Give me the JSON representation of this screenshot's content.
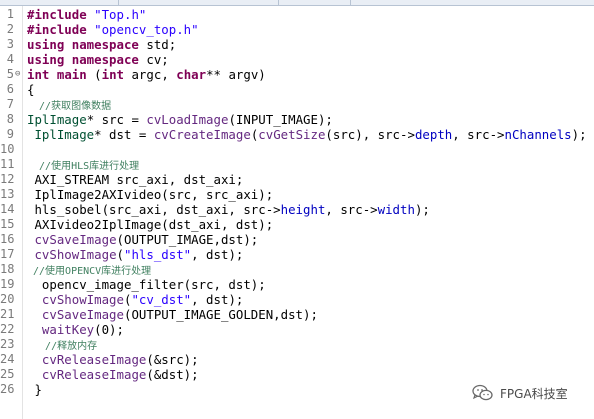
{
  "editor": {
    "line_numbers": [
      "1",
      "2",
      "3",
      "4",
      "5",
      "6",
      "7",
      "8",
      "9",
      "10",
      "11",
      "12",
      "13",
      "14",
      "15",
      "16",
      "17",
      "18",
      "19",
      "20",
      "21",
      "22",
      "23",
      "24",
      "25",
      "26"
    ],
    "fold_marker_line": "5",
    "code": [
      {
        "segs": [
          {
            "t": "#include ",
            "c": "pp"
          },
          {
            "t": "\"Top.h\"",
            "c": "str"
          }
        ]
      },
      {
        "segs": [
          {
            "t": "#include ",
            "c": "pp"
          },
          {
            "t": "\"opencv_top.h\"",
            "c": "str"
          }
        ]
      },
      {
        "segs": [
          {
            "t": "using namespace",
            "c": "kw"
          },
          {
            "t": " std;",
            "c": ""
          }
        ]
      },
      {
        "segs": [
          {
            "t": "using namespace",
            "c": "kw"
          },
          {
            "t": " cv;",
            "c": ""
          }
        ]
      },
      {
        "segs": [
          {
            "t": "int",
            "c": "kw"
          },
          {
            "t": " ",
            "c": ""
          },
          {
            "t": "main",
            "c": "kw"
          },
          {
            "t": " (",
            "c": ""
          },
          {
            "t": "int",
            "c": "kw"
          },
          {
            "t": " argc, ",
            "c": ""
          },
          {
            "t": "char",
            "c": "kw"
          },
          {
            "t": "** argv)",
            "c": ""
          }
        ]
      },
      {
        "segs": [
          {
            "t": "{",
            "c": ""
          }
        ]
      },
      {
        "segs": [
          {
            "t": "  //获取图像数据",
            "c": "cm"
          }
        ]
      },
      {
        "segs": [
          {
            "t": "IplImage",
            "c": "ty"
          },
          {
            "t": "* src = ",
            "c": ""
          },
          {
            "t": "cvLoadImage",
            "c": "fn"
          },
          {
            "t": "(INPUT_IMAGE);",
            "c": ""
          }
        ]
      },
      {
        "segs": [
          {
            "t": " IplImage",
            "c": "ty"
          },
          {
            "t": "* dst = ",
            "c": ""
          },
          {
            "t": "cvCreateImage",
            "c": "fn"
          },
          {
            "t": "(",
            "c": ""
          },
          {
            "t": "cvGetSize",
            "c": "fn"
          },
          {
            "t": "(src), src->",
            "c": ""
          },
          {
            "t": "depth",
            "c": "fd"
          },
          {
            "t": ", src->",
            "c": ""
          },
          {
            "t": "nChannels",
            "c": "fd"
          },
          {
            "t": ");",
            "c": ""
          }
        ]
      },
      {
        "segs": [
          {
            "t": "",
            "c": ""
          }
        ]
      },
      {
        "segs": [
          {
            "t": "  //使用HLS库进行处理",
            "c": "cm"
          }
        ]
      },
      {
        "segs": [
          {
            "t": " AXI_STREAM src_axi, dst_axi;",
            "c": ""
          }
        ]
      },
      {
        "segs": [
          {
            "t": " IplImage2AXIvideo(src, src_axi);",
            "c": ""
          }
        ]
      },
      {
        "segs": [
          {
            "t": " hls_sobel(src_axi, dst_axi, src->",
            "c": ""
          },
          {
            "t": "height",
            "c": "fd"
          },
          {
            "t": ", src->",
            "c": ""
          },
          {
            "t": "width",
            "c": "fd"
          },
          {
            "t": ");",
            "c": ""
          }
        ]
      },
      {
        "segs": [
          {
            "t": " AXIvideo2IplImage(dst_axi, dst);",
            "c": ""
          }
        ]
      },
      {
        "segs": [
          {
            "t": " ",
            "c": ""
          },
          {
            "t": "cvSaveImage",
            "c": "fn"
          },
          {
            "t": "(OUTPUT_IMAGE,dst);",
            "c": ""
          }
        ]
      },
      {
        "segs": [
          {
            "t": " ",
            "c": ""
          },
          {
            "t": "cvShowImage",
            "c": "fn"
          },
          {
            "t": "(",
            "c": ""
          },
          {
            "t": "\"hls_dst\"",
            "c": "str"
          },
          {
            "t": ", dst);",
            "c": ""
          }
        ]
      },
      {
        "segs": [
          {
            "t": " //使用OPENCV库进行处理",
            "c": "cm"
          }
        ]
      },
      {
        "segs": [
          {
            "t": "  opencv_image_filter(src, dst);",
            "c": ""
          }
        ]
      },
      {
        "segs": [
          {
            "t": "  ",
            "c": ""
          },
          {
            "t": "cvShowImage",
            "c": "fn"
          },
          {
            "t": "(",
            "c": ""
          },
          {
            "t": "\"cv_dst\"",
            "c": "str"
          },
          {
            "t": ", dst);",
            "c": ""
          }
        ]
      },
      {
        "segs": [
          {
            "t": "  ",
            "c": ""
          },
          {
            "t": "cvSaveImage",
            "c": "fn"
          },
          {
            "t": "(OUTPUT_IMAGE_GOLDEN,dst);",
            "c": ""
          }
        ]
      },
      {
        "segs": [
          {
            "t": "  ",
            "c": ""
          },
          {
            "t": "waitKey",
            "c": "fn"
          },
          {
            "t": "(0);",
            "c": ""
          }
        ]
      },
      {
        "segs": [
          {
            "t": "   //释放内存",
            "c": "cm"
          }
        ]
      },
      {
        "segs": [
          {
            "t": "  ",
            "c": ""
          },
          {
            "t": "cvReleaseImage",
            "c": "fn"
          },
          {
            "t": "(&src);",
            "c": ""
          }
        ]
      },
      {
        "segs": [
          {
            "t": "  ",
            "c": ""
          },
          {
            "t": "cvReleaseImage",
            "c": "fn"
          },
          {
            "t": "(&dst);",
            "c": ""
          }
        ]
      },
      {
        "segs": [
          {
            "t": " }",
            "c": ""
          }
        ]
      }
    ]
  },
  "watermark": {
    "text": "FPGA科技室",
    "icon": "wechat-icon"
  },
  "colors": {
    "keyword": "#7f0055",
    "string": "#2a00ff",
    "comment": "#3f7f5f",
    "function": "#642880",
    "field": "#0000c0",
    "type": "#005032"
  }
}
